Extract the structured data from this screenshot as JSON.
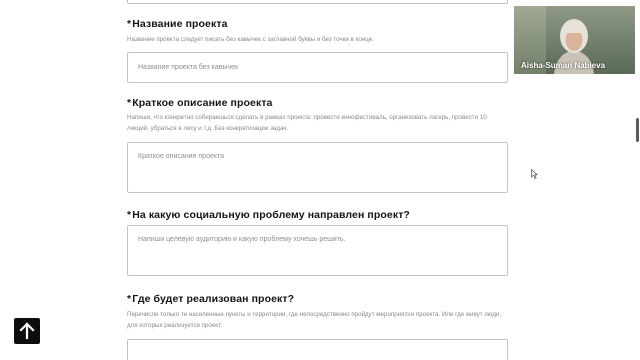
{
  "form": {
    "project_name": {
      "required_mark": "*",
      "label": "Название проекта",
      "hint": "Название проекта следует писать без кавычек с заглавной буквы и без точки в конце.",
      "placeholder": "Название проекта без кавычек"
    },
    "short_description": {
      "required_mark": "*",
      "label": "Краткое описание проекта",
      "hint": "Напиши, что конкретно собираешься сделать в рамках проекта: провести кинофестиваль, организовать лагерь, провести 10 лекций, убраться в лесу и т.д. Без конкретизации задач.",
      "placeholder": "Краткое описание проекта"
    },
    "social_problem": {
      "required_mark": "*",
      "label": "На какую социальную проблему направлен проект?",
      "placeholder": "Напиши целевую аудиторию и какую проблему хочешь решить."
    },
    "location": {
      "required_mark": "*",
      "label": "Где будет реализован проект?",
      "hint": "Перечисли только те населенные пункты и территории, где непосредственно пройдут мероприятия проекта. Или где живут люди, для которых реализуется проект."
    }
  },
  "scroll_top_button": {
    "icon": "arrow-up-icon"
  },
  "video_call": {
    "participant_name": "Aisha-Suman Nabieva"
  },
  "colors": {
    "text": "#151515",
    "hint": "#8a8a8a",
    "border": "#c4c4c4",
    "button": "#0d0d0d"
  }
}
